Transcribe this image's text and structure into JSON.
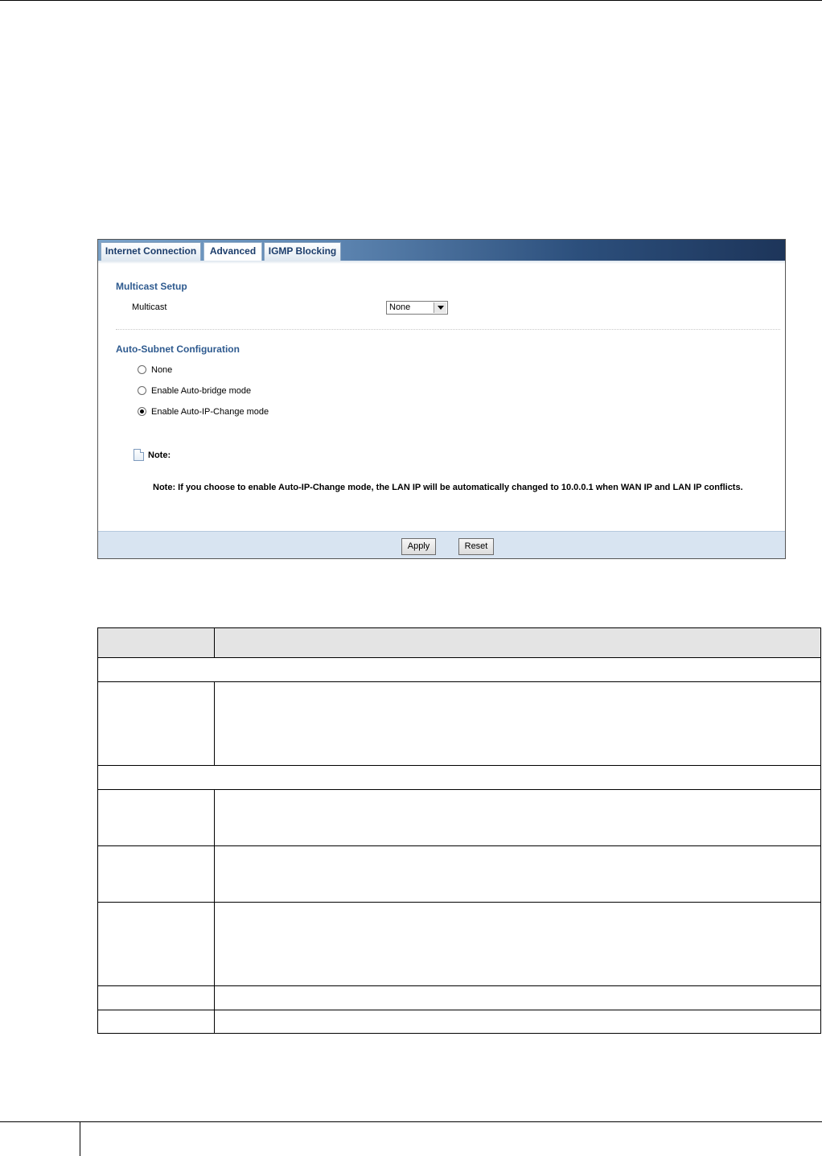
{
  "tabs": [
    {
      "label": "Internet Connection",
      "active": false
    },
    {
      "label": "Advanced",
      "active": true
    },
    {
      "label": "IGMP Blocking",
      "active": false
    }
  ],
  "multicast_setup": {
    "title": "Multicast Setup",
    "field_label": "Multicast",
    "selected_value": "None"
  },
  "auto_subnet": {
    "title": "Auto-Subnet Configuration",
    "options": [
      {
        "label": "None",
        "selected": false
      },
      {
        "label": "Enable Auto-bridge mode",
        "selected": false
      },
      {
        "label": "Enable Auto-IP-Change mode",
        "selected": true
      }
    ]
  },
  "note": {
    "heading": "Note:",
    "text": "Note: If you choose to enable Auto-IP-Change mode, the LAN IP will be automatically changed to 10.0.0.1 when WAN IP and LAN IP conflicts."
  },
  "buttons": {
    "apply": "Apply",
    "reset": "Reset"
  },
  "colors": {
    "tab_text": "#1c3d6b",
    "section_title": "#2e5a8f",
    "footer_bar": "#d8e4f1",
    "table_header": "#e4e4e4"
  }
}
